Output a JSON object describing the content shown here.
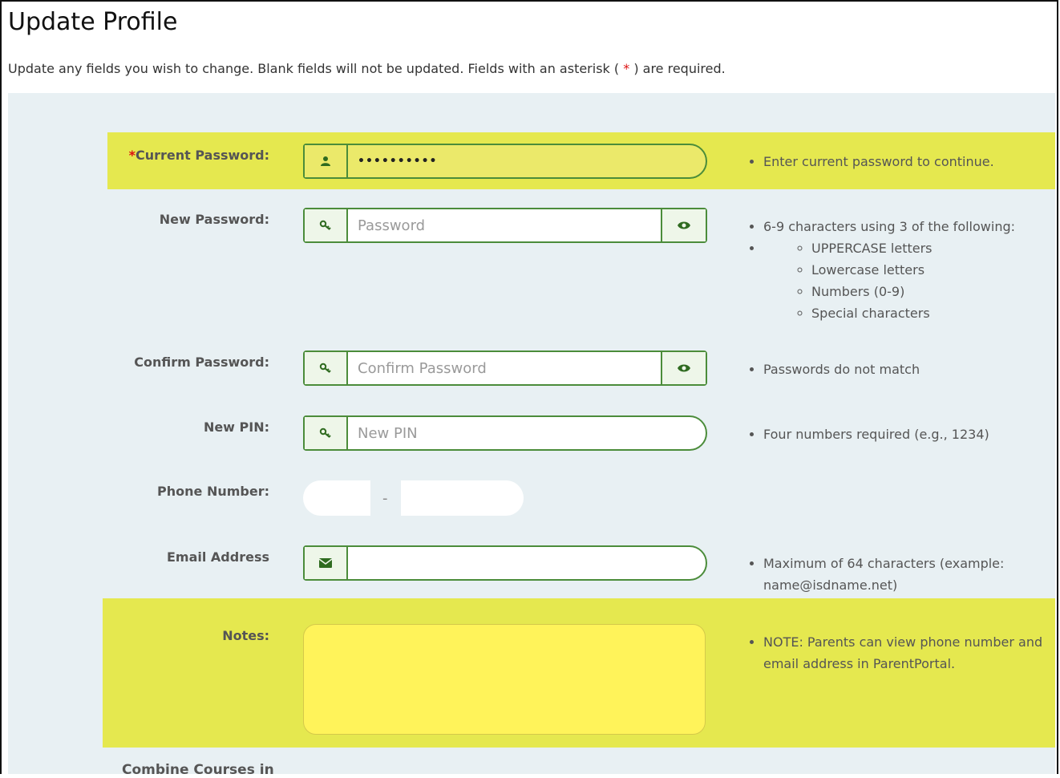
{
  "header": {
    "title": "Update Profile",
    "instructions_before": "Update any fields you wish to change. Blank fields will not be updated. Fields with an asterisk (",
    "asterisk": " * ",
    "instructions_after": ") are required."
  },
  "current_password": {
    "required_mark": "*",
    "label": "Current Password:",
    "value": "••••••••••",
    "icon": "user-icon",
    "hint": "Enter current password to continue."
  },
  "new_password": {
    "label": "New Password:",
    "placeholder": "Password",
    "icon": "key-icon",
    "toggle_icon": "eye-icon",
    "hint_intro": "6-9 characters using 3 of the following:",
    "rules": [
      "UPPERCASE letters",
      "Lowercase letters",
      "Numbers (0-9)",
      "Special characters"
    ]
  },
  "confirm_password": {
    "label": "Confirm Password:",
    "placeholder": "Confirm Password",
    "icon": "key-icon",
    "toggle_icon": "eye-icon",
    "hint": "Passwords do not match"
  },
  "new_pin": {
    "label": "New PIN:",
    "placeholder": "New PIN",
    "icon": "key-icon",
    "hint": "Four numbers required (e.g., 1234)"
  },
  "phone": {
    "label": "Phone Number:",
    "separator": "-",
    "prefix_value": "",
    "number_value": ""
  },
  "email": {
    "label": "Email Address",
    "value": "",
    "icon": "envelope-icon",
    "hint": "Maximum of 64 characters (example: name@isdname.net)"
  },
  "notes": {
    "label": "Notes:",
    "hint": "NOTE: Parents can view phone number and email address in ParentPortal."
  },
  "next_section_label": "Combine Courses in",
  "colors": {
    "highlight": "#e5e84f",
    "field_border": "#4b8c3a",
    "panel_bg": "#e8f0f3",
    "required": "#dd1111",
    "notes_bg": "#fff35a"
  }
}
